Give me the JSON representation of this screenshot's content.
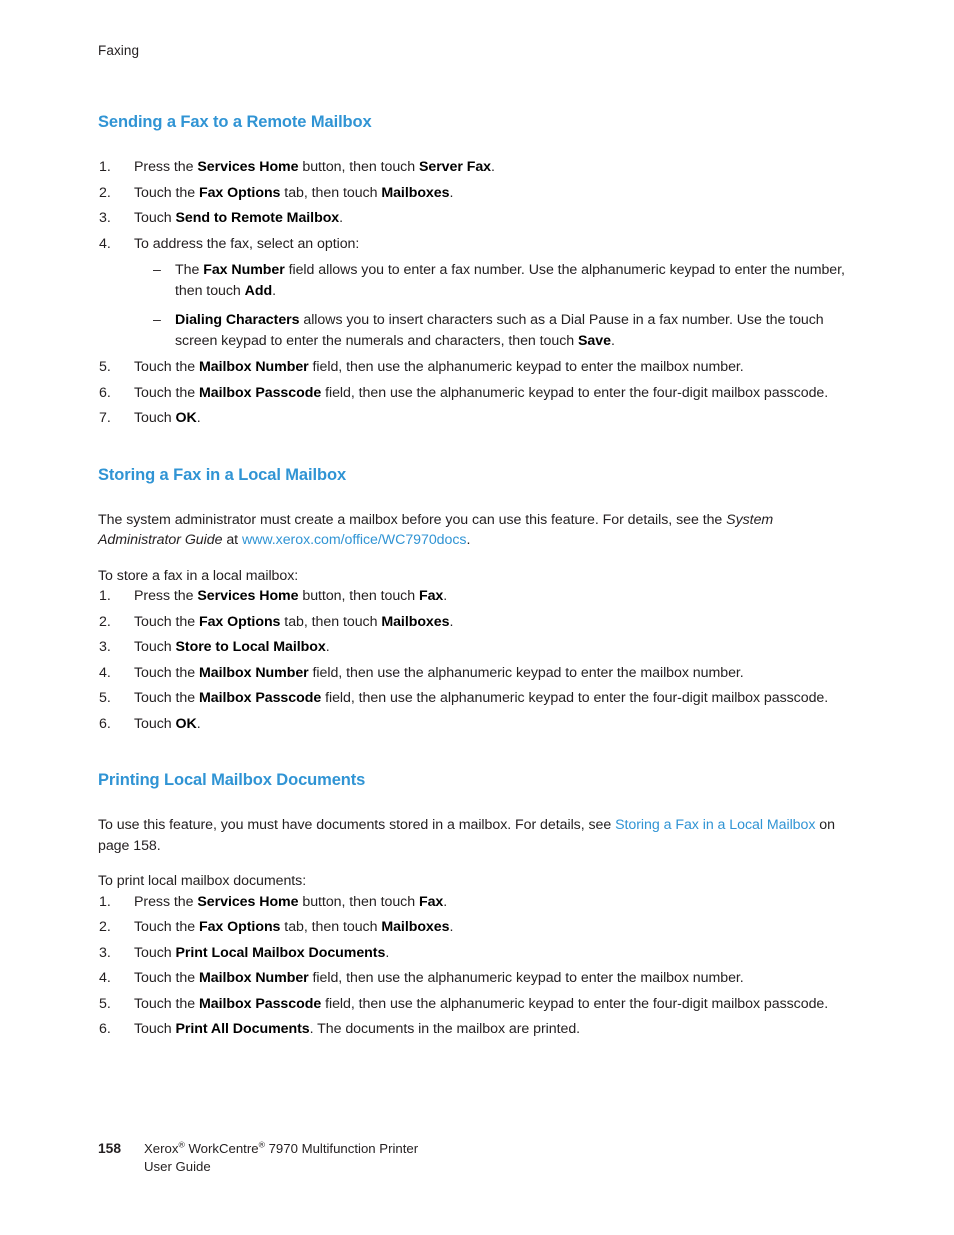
{
  "running_head": "Faxing",
  "sections": [
    {
      "heading": "Sending a Fax to a Remote Mailbox",
      "steps": [
        {
          "num": "1.",
          "parts": [
            {
              "t": "Press the ",
              "s": "n"
            },
            {
              "t": "Services Home",
              "s": "b"
            },
            {
              "t": " button, then touch ",
              "s": "n"
            },
            {
              "t": "Server Fax",
              "s": "b"
            },
            {
              "t": ".",
              "s": "n"
            }
          ]
        },
        {
          "num": "2.",
          "parts": [
            {
              "t": "Touch the ",
              "s": "n"
            },
            {
              "t": "Fax Options",
              "s": "b"
            },
            {
              "t": " tab, then touch ",
              "s": "n"
            },
            {
              "t": "Mailboxes",
              "s": "b"
            },
            {
              "t": ".",
              "s": "n"
            }
          ]
        },
        {
          "num": "3.",
          "parts": [
            {
              "t": "Touch ",
              "s": "n"
            },
            {
              "t": "Send to Remote Mailbox",
              "s": "b"
            },
            {
              "t": ".",
              "s": "n"
            }
          ]
        },
        {
          "num": "4.",
          "parts": [
            {
              "t": "To address the fax, select an option:",
              "s": "n"
            }
          ],
          "substeps": [
            {
              "dash": "–",
              "parts": [
                {
                  "t": "The ",
                  "s": "n"
                },
                {
                  "t": "Fax Number",
                  "s": "b"
                },
                {
                  "t": " field allows you to enter a fax number. Use the alphanumeric keypad to enter the number, then touch ",
                  "s": "n"
                },
                {
                  "t": "Add",
                  "s": "b"
                },
                {
                  "t": ".",
                  "s": "n"
                }
              ]
            },
            {
              "dash": "–",
              "parts": [
                {
                  "t": "Dialing Characters",
                  "s": "b"
                },
                {
                  "t": " allows you to insert characters such as a Dial Pause in a fax number. Use the touch screen keypad to enter the numerals and characters, then touch ",
                  "s": "n"
                },
                {
                  "t": "Save",
                  "s": "b"
                },
                {
                  "t": ".",
                  "s": "n"
                }
              ]
            }
          ]
        },
        {
          "num": "5.",
          "parts": [
            {
              "t": "Touch the ",
              "s": "n"
            },
            {
              "t": "Mailbox Number",
              "s": "b"
            },
            {
              "t": " field, then use the alphanumeric keypad to enter the mailbox number.",
              "s": "n"
            }
          ]
        },
        {
          "num": "6.",
          "parts": [
            {
              "t": "Touch the ",
              "s": "n"
            },
            {
              "t": "Mailbox Passcode",
              "s": "b"
            },
            {
              "t": " field, then use the alphanumeric keypad to enter the four-digit mailbox passcode.",
              "s": "n"
            }
          ]
        },
        {
          "num": "7.",
          "parts": [
            {
              "t": "Touch ",
              "s": "n"
            },
            {
              "t": "OK",
              "s": "b"
            },
            {
              "t": ".",
              "s": "n"
            }
          ]
        }
      ]
    },
    {
      "heading": "Storing a Fax in a Local Mailbox",
      "intro": [
        {
          "t": "The system administrator must create a mailbox before you can use this feature. For details, see the ",
          "s": "n"
        },
        {
          "t": "System Administrator Guide",
          "s": "i"
        },
        {
          "t": " at ",
          "s": "n"
        },
        {
          "t": "www.xerox.com/office/WC7970docs",
          "s": "link"
        },
        {
          "t": ".",
          "s": "n"
        }
      ],
      "lead_in": "To store a fax in a local mailbox:",
      "steps": [
        {
          "num": "1.",
          "parts": [
            {
              "t": "Press the ",
              "s": "n"
            },
            {
              "t": "Services Home",
              "s": "b"
            },
            {
              "t": " button, then touch ",
              "s": "n"
            },
            {
              "t": "Fax",
              "s": "b"
            },
            {
              "t": ".",
              "s": "n"
            }
          ]
        },
        {
          "num": "2.",
          "parts": [
            {
              "t": "Touch the ",
              "s": "n"
            },
            {
              "t": "Fax Options",
              "s": "b"
            },
            {
              "t": " tab, then touch ",
              "s": "n"
            },
            {
              "t": "Mailboxes",
              "s": "b"
            },
            {
              "t": ".",
              "s": "n"
            }
          ]
        },
        {
          "num": "3.",
          "parts": [
            {
              "t": "Touch ",
              "s": "n"
            },
            {
              "t": "Store to Local Mailbox",
              "s": "b"
            },
            {
              "t": ".",
              "s": "n"
            }
          ]
        },
        {
          "num": "4.",
          "parts": [
            {
              "t": "Touch the ",
              "s": "n"
            },
            {
              "t": "Mailbox Number",
              "s": "b"
            },
            {
              "t": " field, then use the alphanumeric keypad to enter the mailbox number.",
              "s": "n"
            }
          ]
        },
        {
          "num": "5.",
          "parts": [
            {
              "t": "Touch the ",
              "s": "n"
            },
            {
              "t": "Mailbox Passcode",
              "s": "b"
            },
            {
              "t": " field, then use the alphanumeric keypad to enter the four-digit mailbox passcode.",
              "s": "n"
            }
          ]
        },
        {
          "num": "6.",
          "parts": [
            {
              "t": "Touch ",
              "s": "n"
            },
            {
              "t": "OK",
              "s": "b"
            },
            {
              "t": ".",
              "s": "n"
            }
          ]
        }
      ]
    },
    {
      "heading": "Printing Local Mailbox Documents",
      "intro": [
        {
          "t": "To use this feature, you must have documents stored in a mailbox. For details, see ",
          "s": "n"
        },
        {
          "t": "Storing a Fax in a Local Mailbox",
          "s": "link"
        },
        {
          "t": " on page 158.",
          "s": "n"
        }
      ],
      "lead_in": "To print local mailbox documents:",
      "steps": [
        {
          "num": "1.",
          "parts": [
            {
              "t": "Press the ",
              "s": "n"
            },
            {
              "t": "Services Home",
              "s": "b"
            },
            {
              "t": " button, then touch ",
              "s": "n"
            },
            {
              "t": "Fax",
              "s": "b"
            },
            {
              "t": ".",
              "s": "n"
            }
          ]
        },
        {
          "num": "2.",
          "parts": [
            {
              "t": "Touch the ",
              "s": "n"
            },
            {
              "t": "Fax Options",
              "s": "b"
            },
            {
              "t": " tab, then touch ",
              "s": "n"
            },
            {
              "t": "Mailboxes",
              "s": "b"
            },
            {
              "t": ".",
              "s": "n"
            }
          ]
        },
        {
          "num": "3.",
          "parts": [
            {
              "t": "Touch ",
              "s": "n"
            },
            {
              "t": "Print Local Mailbox Documents",
              "s": "b"
            },
            {
              "t": ".",
              "s": "n"
            }
          ]
        },
        {
          "num": "4.",
          "parts": [
            {
              "t": "Touch the ",
              "s": "n"
            },
            {
              "t": "Mailbox Number",
              "s": "b"
            },
            {
              "t": " field, then use the alphanumeric keypad to enter the mailbox number.",
              "s": "n"
            }
          ]
        },
        {
          "num": "5.",
          "parts": [
            {
              "t": "Touch the ",
              "s": "n"
            },
            {
              "t": "Mailbox Passcode",
              "s": "b"
            },
            {
              "t": " field, then use the alphanumeric keypad to enter the four-digit mailbox passcode.",
              "s": "n"
            }
          ]
        },
        {
          "num": "6.",
          "parts": [
            {
              "t": "Touch ",
              "s": "n"
            },
            {
              "t": "Print All Documents",
              "s": "b"
            },
            {
              "t": ". The documents in the mailbox are printed.",
              "s": "n"
            }
          ]
        }
      ]
    }
  ],
  "footer": {
    "page_number": "158",
    "product_line_parts": [
      {
        "t": "Xerox",
        "s": "n"
      },
      {
        "t": "®",
        "s": "sup"
      },
      {
        "t": " WorkCentre",
        "s": "n"
      },
      {
        "t": "®",
        "s": "sup"
      },
      {
        "t": " 7970 Multifunction Printer",
        "s": "n"
      }
    ],
    "guide_line": "User Guide"
  },
  "colors": {
    "heading_blue": "#3094d4",
    "link_blue": "#3094d4",
    "body_black": "#231f20",
    "page_background": "#ffffff"
  }
}
